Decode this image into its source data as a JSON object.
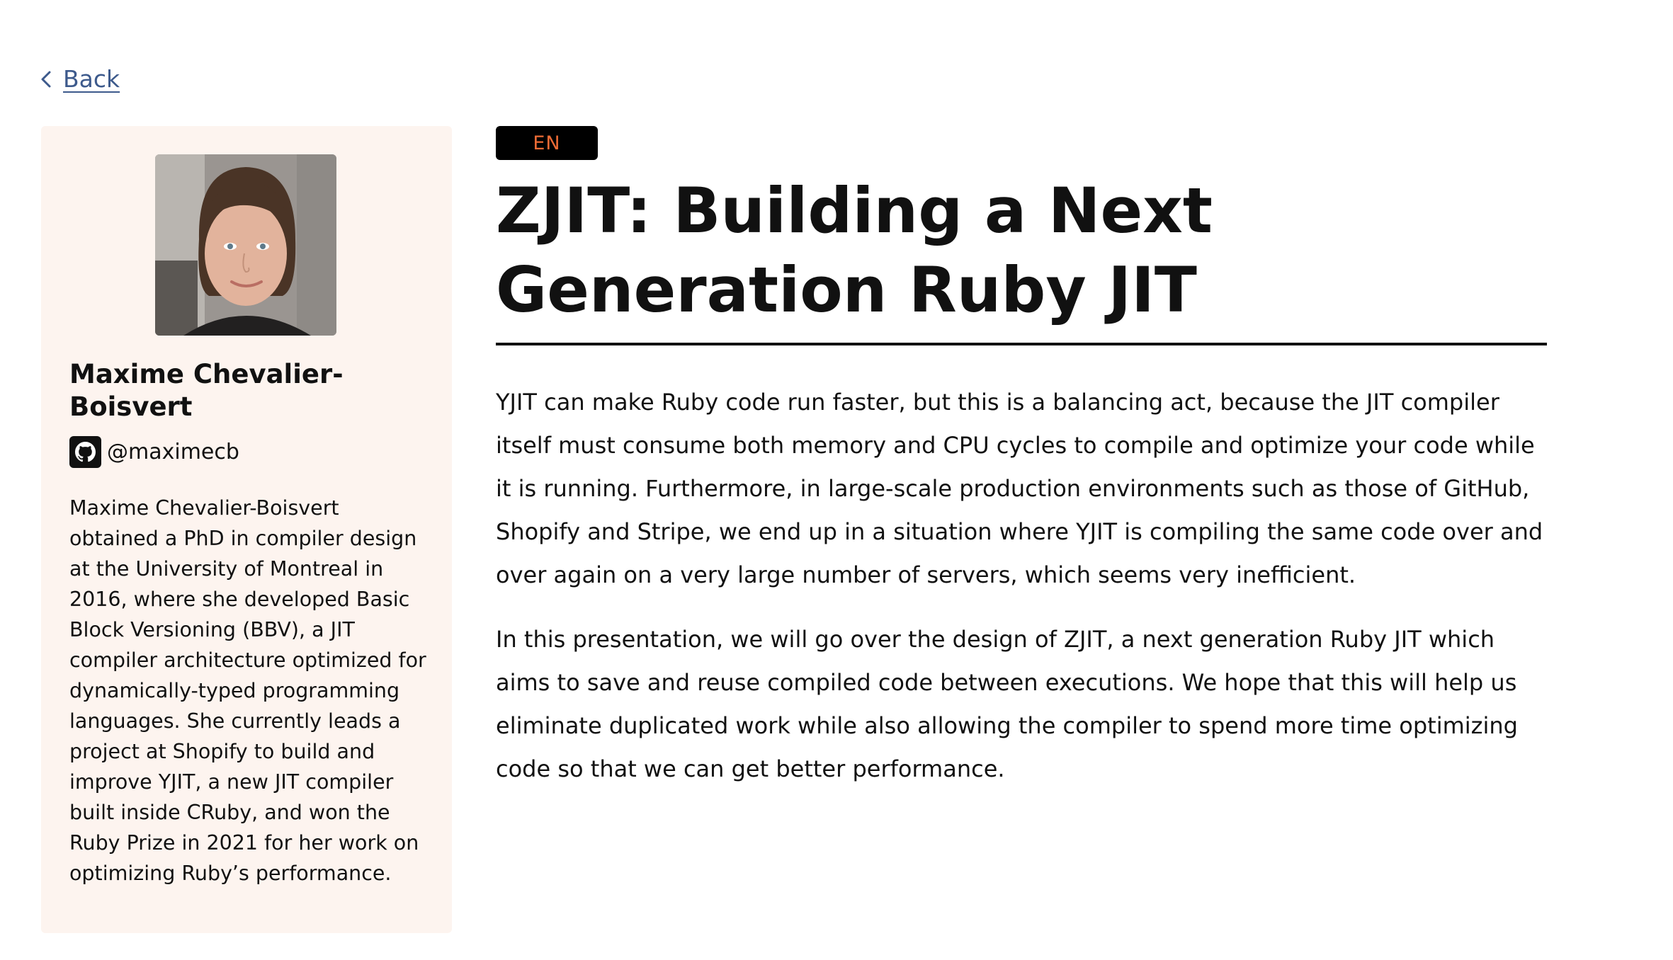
{
  "nav": {
    "back_label": "Back"
  },
  "speaker": {
    "name": "Maxime Chevalier-Boisvert",
    "github_handle": "@maximecb",
    "bio": "Maxime Chevalier-Boisvert obtained a PhD in compiler design at the University of Montreal in 2016, where she developed Basic Block Versioning (BBV), a JIT compiler architecture optimized for dynamically-typed programming languages. She currently leads a project at Shopify to build and improve YJIT, a new JIT compiler built inside CRuby, and won the Ruby Prize in 2021 for her work on optimizing Ruby’s performance.",
    "avatar_icon": "speaker-photo",
    "github_icon": "github-icon"
  },
  "talk": {
    "language": "EN",
    "title": "ZJIT: Building a Next Generation Ruby JIT",
    "abstract": [
      "YJIT can make Ruby code run faster, but this is a balancing act, because the JIT compiler itself must consume both memory and CPU cycles to compile and optimize your code while it is running. Furthermore, in large-scale production environments such as those of GitHub, Shopify and Stripe, we end up in a situation where YJIT is compiling the same code over and over again on a very large number of servers, which seems very inefficient.",
      "In this presentation, we will go over the design of ZJIT, a next generation Ruby JIT which aims to save and reuse compiled code between executions. We hope that this will help us eliminate duplicated work while also allowing the compiler to spend more time optimizing code so that we can get better performance."
    ]
  },
  "colors": {
    "link": "#3d5a8c",
    "card_background": "#fdf4ef",
    "badge_background": "#000000",
    "badge_text": "#ec6b35",
    "text": "#111111"
  }
}
